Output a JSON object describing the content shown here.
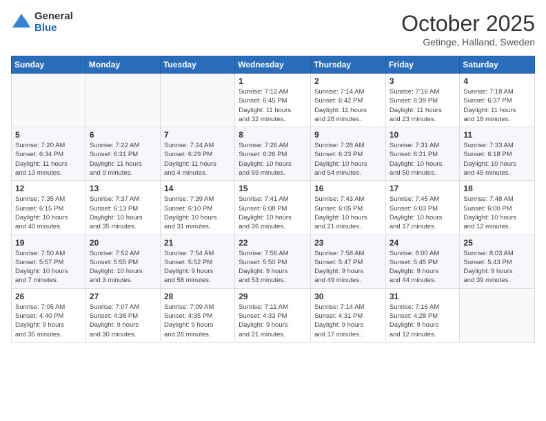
{
  "logo": {
    "general": "General",
    "blue": "Blue"
  },
  "header": {
    "month": "October 2025",
    "location": "Getinge, Halland, Sweden"
  },
  "weekdays": [
    "Sunday",
    "Monday",
    "Tuesday",
    "Wednesday",
    "Thursday",
    "Friday",
    "Saturday"
  ],
  "weeks": [
    [
      {
        "day": "",
        "info": ""
      },
      {
        "day": "",
        "info": ""
      },
      {
        "day": "",
        "info": ""
      },
      {
        "day": "1",
        "info": "Sunrise: 7:12 AM\nSunset: 6:45 PM\nDaylight: 11 hours\nand 32 minutes."
      },
      {
        "day": "2",
        "info": "Sunrise: 7:14 AM\nSunset: 6:42 PM\nDaylight: 11 hours\nand 28 minutes."
      },
      {
        "day": "3",
        "info": "Sunrise: 7:16 AM\nSunset: 6:39 PM\nDaylight: 11 hours\nand 23 minutes."
      },
      {
        "day": "4",
        "info": "Sunrise: 7:18 AM\nSunset: 6:37 PM\nDaylight: 11 hours\nand 18 minutes."
      }
    ],
    [
      {
        "day": "5",
        "info": "Sunrise: 7:20 AM\nSunset: 6:34 PM\nDaylight: 11 hours\nand 13 minutes."
      },
      {
        "day": "6",
        "info": "Sunrise: 7:22 AM\nSunset: 6:31 PM\nDaylight: 11 hours\nand 9 minutes."
      },
      {
        "day": "7",
        "info": "Sunrise: 7:24 AM\nSunset: 6:29 PM\nDaylight: 11 hours\nand 4 minutes."
      },
      {
        "day": "8",
        "info": "Sunrise: 7:26 AM\nSunset: 6:26 PM\nDaylight: 10 hours\nand 59 minutes."
      },
      {
        "day": "9",
        "info": "Sunrise: 7:28 AM\nSunset: 6:23 PM\nDaylight: 10 hours\nand 54 minutes."
      },
      {
        "day": "10",
        "info": "Sunrise: 7:31 AM\nSunset: 6:21 PM\nDaylight: 10 hours\nand 50 minutes."
      },
      {
        "day": "11",
        "info": "Sunrise: 7:33 AM\nSunset: 6:18 PM\nDaylight: 10 hours\nand 45 minutes."
      }
    ],
    [
      {
        "day": "12",
        "info": "Sunrise: 7:35 AM\nSunset: 6:15 PM\nDaylight: 10 hours\nand 40 minutes."
      },
      {
        "day": "13",
        "info": "Sunrise: 7:37 AM\nSunset: 6:13 PM\nDaylight: 10 hours\nand 35 minutes."
      },
      {
        "day": "14",
        "info": "Sunrise: 7:39 AM\nSunset: 6:10 PM\nDaylight: 10 hours\nand 31 minutes."
      },
      {
        "day": "15",
        "info": "Sunrise: 7:41 AM\nSunset: 6:08 PM\nDaylight: 10 hours\nand 26 minutes."
      },
      {
        "day": "16",
        "info": "Sunrise: 7:43 AM\nSunset: 6:05 PM\nDaylight: 10 hours\nand 21 minutes."
      },
      {
        "day": "17",
        "info": "Sunrise: 7:45 AM\nSunset: 6:03 PM\nDaylight: 10 hours\nand 17 minutes."
      },
      {
        "day": "18",
        "info": "Sunrise: 7:48 AM\nSunset: 6:00 PM\nDaylight: 10 hours\nand 12 minutes."
      }
    ],
    [
      {
        "day": "19",
        "info": "Sunrise: 7:50 AM\nSunset: 5:57 PM\nDaylight: 10 hours\nand 7 minutes."
      },
      {
        "day": "20",
        "info": "Sunrise: 7:52 AM\nSunset: 5:55 PM\nDaylight: 10 hours\nand 3 minutes."
      },
      {
        "day": "21",
        "info": "Sunrise: 7:54 AM\nSunset: 5:52 PM\nDaylight: 9 hours\nand 58 minutes."
      },
      {
        "day": "22",
        "info": "Sunrise: 7:56 AM\nSunset: 5:50 PM\nDaylight: 9 hours\nand 53 minutes."
      },
      {
        "day": "23",
        "info": "Sunrise: 7:58 AM\nSunset: 5:47 PM\nDaylight: 9 hours\nand 49 minutes."
      },
      {
        "day": "24",
        "info": "Sunrise: 8:00 AM\nSunset: 5:45 PM\nDaylight: 9 hours\nand 44 minutes."
      },
      {
        "day": "25",
        "info": "Sunrise: 8:03 AM\nSunset: 5:43 PM\nDaylight: 9 hours\nand 39 minutes."
      }
    ],
    [
      {
        "day": "26",
        "info": "Sunrise: 7:05 AM\nSunset: 4:40 PM\nDaylight: 9 hours\nand 35 minutes."
      },
      {
        "day": "27",
        "info": "Sunrise: 7:07 AM\nSunset: 4:38 PM\nDaylight: 9 hours\nand 30 minutes."
      },
      {
        "day": "28",
        "info": "Sunrise: 7:09 AM\nSunset: 4:35 PM\nDaylight: 9 hours\nand 26 minutes."
      },
      {
        "day": "29",
        "info": "Sunrise: 7:11 AM\nSunset: 4:33 PM\nDaylight: 9 hours\nand 21 minutes."
      },
      {
        "day": "30",
        "info": "Sunrise: 7:14 AM\nSunset: 4:31 PM\nDaylight: 9 hours\nand 17 minutes."
      },
      {
        "day": "31",
        "info": "Sunrise: 7:16 AM\nSunset: 4:28 PM\nDaylight: 9 hours\nand 12 minutes."
      },
      {
        "day": "",
        "info": ""
      }
    ]
  ]
}
